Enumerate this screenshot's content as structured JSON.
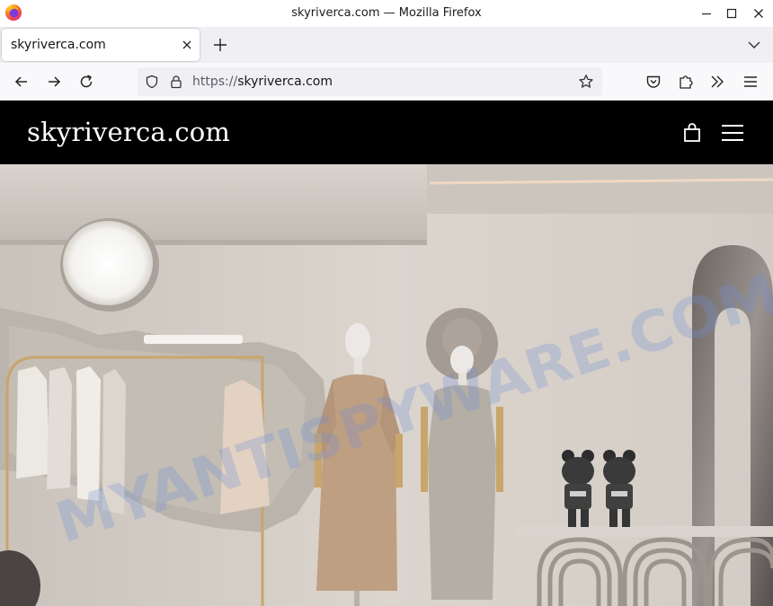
{
  "window": {
    "title": "skyriverca.com — Mozilla Firefox"
  },
  "tabs": [
    {
      "label": "skyriverca.com",
      "active": true
    }
  ],
  "address_bar": {
    "scheme": "https://",
    "host": "skyriverca.com"
  },
  "site": {
    "logo_text": "skyriverca.com"
  },
  "hero": {
    "watermark_text": "MYANTISPYWARE.COM"
  },
  "colors": {
    "header_bg": "#000000",
    "header_text": "#ffffff",
    "wall": "#d6cfc6",
    "watermark": "#6f8fd6"
  },
  "icons": {
    "browser_logo": "firefox-logo-icon",
    "back": "arrow-left-icon",
    "forward": "arrow-right-icon",
    "reload": "reload-icon",
    "tracking": "shield-icon",
    "secure": "lock-icon",
    "bookmark": "star-icon",
    "pocket": "pocket-icon",
    "extensions": "puzzle-icon",
    "overflow": "chevron-double-right-icon",
    "app_menu": "hamburger-icon",
    "cart": "shopping-bag-icon",
    "site_menu": "menu-icon"
  }
}
